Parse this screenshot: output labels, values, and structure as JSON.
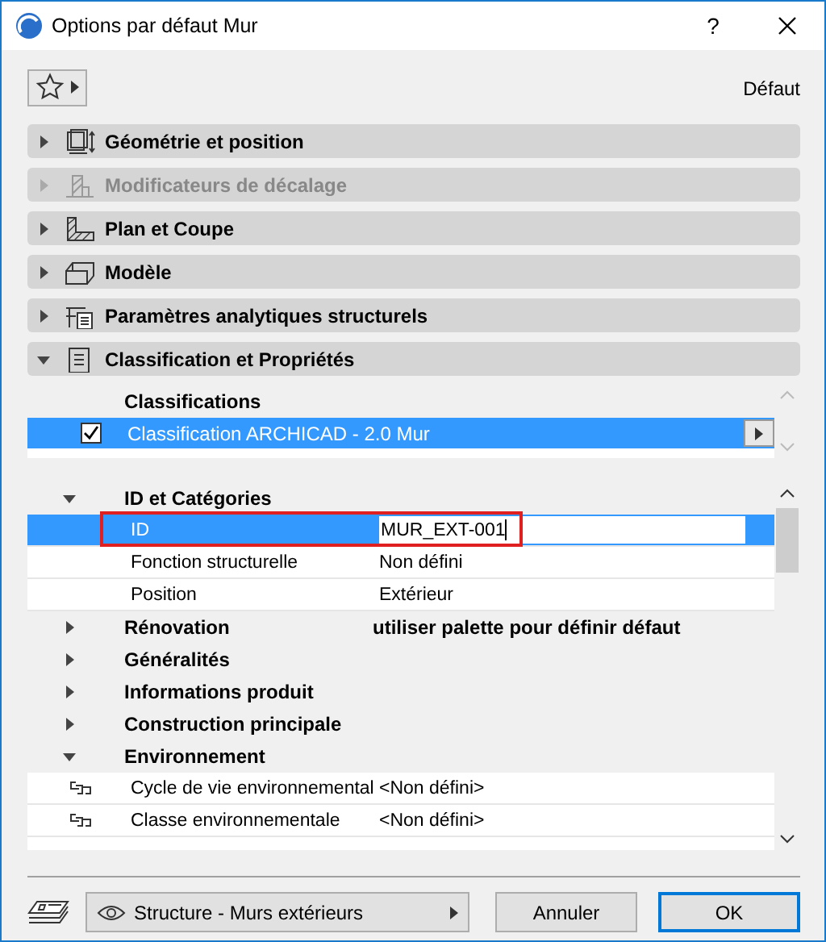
{
  "window": {
    "title": "Options par défaut Mur",
    "help": "?"
  },
  "toolbar": {
    "favorites_open": false,
    "default_label": "Défaut"
  },
  "sections": [
    {
      "title": "Géométrie et position",
      "expanded": false,
      "disabled": false
    },
    {
      "title": "Modificateurs de décalage",
      "expanded": false,
      "disabled": true
    },
    {
      "title": "Plan et Coupe",
      "expanded": false,
      "disabled": false
    },
    {
      "title": "Modèle",
      "expanded": false,
      "disabled": false
    },
    {
      "title": "Paramètres analytiques structurels",
      "expanded": false,
      "disabled": false
    },
    {
      "title": "Classification et Propriétés",
      "expanded": true,
      "disabled": false
    }
  ],
  "classification": {
    "heading": "Classifications",
    "rows": [
      {
        "label": "Classification ARCHICAD - 2.0 Mur",
        "checked": true,
        "selected": true
      }
    ]
  },
  "properties": [
    {
      "kind": "group",
      "title": "ID et Catégories",
      "expanded": true,
      "children": [
        {
          "kind": "property",
          "label": "ID",
          "value": "MUR_EXT-001",
          "selected": true,
          "editing": true,
          "highlighted": true,
          "linked": false
        },
        {
          "kind": "property",
          "label": "Fonction structurelle",
          "value": "Non défini",
          "selected": false,
          "editing": false,
          "highlighted": false,
          "linked": false
        },
        {
          "kind": "property",
          "label": "Position",
          "value": "Extérieur",
          "selected": false,
          "editing": false,
          "highlighted": false,
          "linked": false
        }
      ]
    },
    {
      "kind": "group",
      "title": "Rénovation",
      "value": "utiliser palette pour définir défaut",
      "expanded": false
    },
    {
      "kind": "group",
      "title": "Généralités",
      "expanded": false
    },
    {
      "kind": "group",
      "title": "Informations produit",
      "expanded": false
    },
    {
      "kind": "group",
      "title": "Construction principale",
      "expanded": false
    },
    {
      "kind": "group",
      "title": "Environnement",
      "expanded": true,
      "children": [
        {
          "kind": "property",
          "label": "Cycle de vie environnemental",
          "value": "<Non défini>",
          "selected": false,
          "editing": false,
          "highlighted": false,
          "linked": true
        },
        {
          "kind": "property",
          "label": "Classe environnementale",
          "value": "<Non défini>",
          "selected": false,
          "editing": false,
          "highlighted": false,
          "linked": true
        }
      ]
    }
  ],
  "footer": {
    "layer_combo": "Structure - Murs extérieurs",
    "buttons": [
      {
        "label": "Annuler",
        "default": false
      },
      {
        "label": "OK",
        "default": true
      }
    ]
  }
}
